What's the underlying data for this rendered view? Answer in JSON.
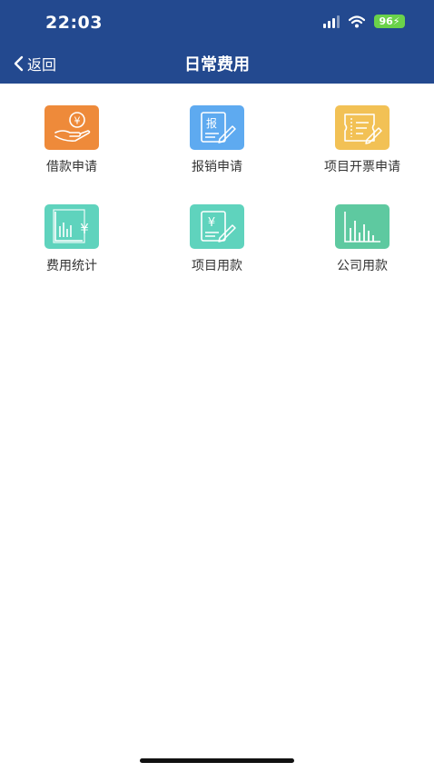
{
  "status_bar": {
    "time": "22:03",
    "battery": "96",
    "icons": [
      "cellular-signal-icon",
      "wifi-icon",
      "battery-charging-icon"
    ]
  },
  "nav": {
    "back_label": "返回",
    "title": "日常费用"
  },
  "menu": [
    {
      "label": "借款申请",
      "icon": "loan-hand-yen-icon",
      "color": "#ee8a3a"
    },
    {
      "label": "报销申请",
      "icon": "reimbursement-form-icon",
      "color": "#5eaaf0"
    },
    {
      "label": "项目开票申请",
      "icon": "invoice-ticket-icon",
      "color": "#f2c155"
    },
    {
      "label": "费用统计",
      "icon": "expense-chart-yen-icon",
      "color": "#5fd3bd"
    },
    {
      "label": "项目用款",
      "icon": "project-payment-form-icon",
      "color": "#5fd3bd"
    },
    {
      "label": "公司用款",
      "icon": "company-bar-chart-icon",
      "color": "#5ec9a0"
    }
  ],
  "colors": {
    "header_bg": "#23498f",
    "page_bg": "#ffffff"
  }
}
